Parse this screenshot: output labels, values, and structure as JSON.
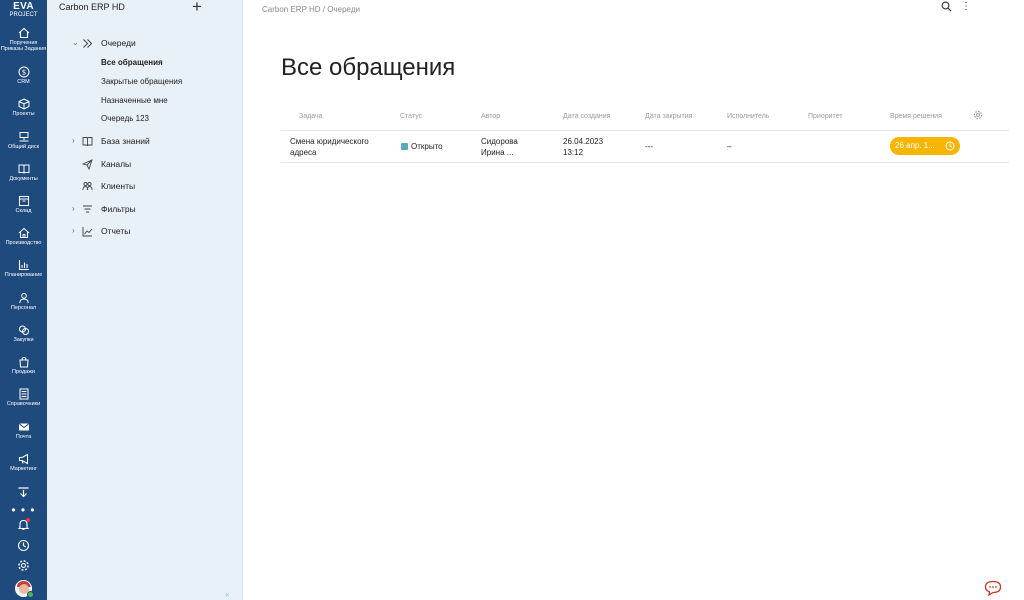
{
  "app": {
    "logo_line1": "EVA",
    "logo_line2": "PROJECT"
  },
  "rail": {
    "items": [
      {
        "label": "Поручения Приказы Задания",
        "icon": "home-icon"
      },
      {
        "label": "CRM",
        "icon": "dollar-icon"
      },
      {
        "label": "Проекты",
        "icon": "cube-icon"
      },
      {
        "label": "Общий диск",
        "icon": "disk-icon"
      },
      {
        "label": "Документы",
        "icon": "book-icon"
      },
      {
        "label": "Склад",
        "icon": "box-icon"
      },
      {
        "label": "Производство",
        "icon": "factory-icon"
      },
      {
        "label": "Планирование",
        "icon": "chart-icon"
      },
      {
        "label": "Персонал",
        "icon": "person-icon"
      },
      {
        "label": "Закупки",
        "icon": "coins-icon"
      },
      {
        "label": "Продажи",
        "icon": "bag-icon"
      },
      {
        "label": "Справочники",
        "icon": "list-icon"
      },
      {
        "label": "Почта",
        "icon": "mail-icon"
      },
      {
        "label": "Маркетинг",
        "icon": "megaphone-icon"
      }
    ],
    "more": "• • •"
  },
  "nav": {
    "title": "Carbon ERP HD",
    "add": "+",
    "queues_label": "Очереди",
    "sub_items": [
      {
        "label": "Все обращения",
        "active": true
      },
      {
        "label": "Закрытые обращения",
        "active": false
      },
      {
        "label": "Назначенные мне",
        "active": false
      },
      {
        "label": "Очередь 123",
        "active": false
      }
    ],
    "knowledge_label": "База знаний",
    "channels_label": "Каналы",
    "clients_label": "Клиенты",
    "filters_label": "Фильтры",
    "reports_label": "Отчеты",
    "collapse": "«"
  },
  "main": {
    "breadcrumb_root": "Carbon ERP HD",
    "breadcrumb_sep": "/",
    "breadcrumb_current": "Очереди",
    "title": "Все обращения",
    "columns": {
      "task": "Задача",
      "status": "Статус",
      "author": "Автор",
      "created": "Дата создания",
      "closed": "Дата закрытия",
      "assignee": "Исполнитель",
      "priority": "Приоритет",
      "resolve_time": "Время решения"
    },
    "rows": [
      {
        "task_line1": "Смена юридического",
        "task_line2": "адреса",
        "status": "Открыто",
        "status_color": "#5aa9bd",
        "author_line1": "Сидорова",
        "author_line2": "Ирина ...",
        "created_line1": "26.04.2023",
        "created_line2": "13:12",
        "closed": "---",
        "assignee": "–",
        "priority": "",
        "deadline": "26 апр. 1..."
      }
    ]
  },
  "colors": {
    "rail": "#1e4a7d",
    "nav_bg": "#e8f0f8",
    "deadline": "#f7b500"
  }
}
